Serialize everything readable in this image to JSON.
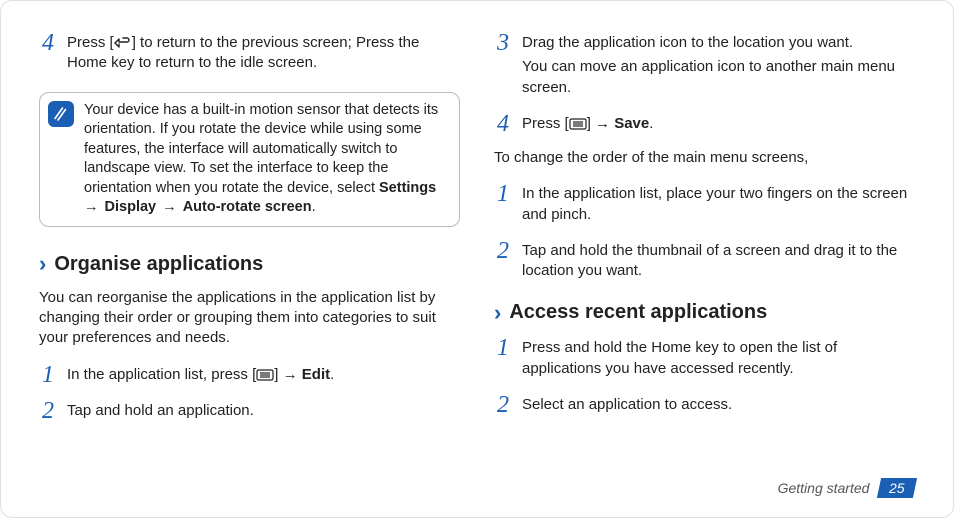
{
  "left": {
    "step4": {
      "num": "4",
      "text_a": "Press [",
      "text_b": "] to return to the previous screen; Press the Home key to return to the idle screen."
    },
    "note": {
      "text_a": "Your device has a built-in motion sensor that detects its orientation. If you rotate the device while using some features, the interface will automatically switch to landscape view. To set the interface to keep the orientation when you rotate the device, select ",
      "b1": "Settings",
      "arr1": " → ",
      "b2": "Display",
      "arr2": " → ",
      "b3": "Auto-rotate screen",
      "period": "."
    },
    "heading1": "Organise applications",
    "intro1": "You can reorganise the applications in the application list by changing their order or grouping them into categories to suit your preferences and needs.",
    "s1": {
      "num": "1",
      "text_a": "In the application list, press [",
      "text_b": "] → ",
      "bold": "Edit",
      "period": "."
    },
    "s2": {
      "num": "2",
      "text": "Tap and hold an application."
    }
  },
  "right": {
    "s3": {
      "num": "3",
      "line1": "Drag the application icon to the location you want.",
      "line2": "You can move an application icon to another main menu screen."
    },
    "s4": {
      "num": "4",
      "text_a": "Press [",
      "text_b": "] → ",
      "bold": "Save",
      "period": "."
    },
    "intro2": "To change the order of the main menu screens,",
    "t1": {
      "num": "1",
      "text": "In the application list, place your two fingers on the screen and pinch."
    },
    "t2": {
      "num": "2",
      "text": "Tap and hold the thumbnail of a screen and drag it to the location you want."
    },
    "heading2": "Access recent applications",
    "u1": {
      "num": "1",
      "text": "Press and hold the Home key to open the list of applications you have accessed recently."
    },
    "u2": {
      "num": "2",
      "text": "Select an application to access."
    }
  },
  "footer": {
    "section": "Getting started",
    "page": "25"
  }
}
